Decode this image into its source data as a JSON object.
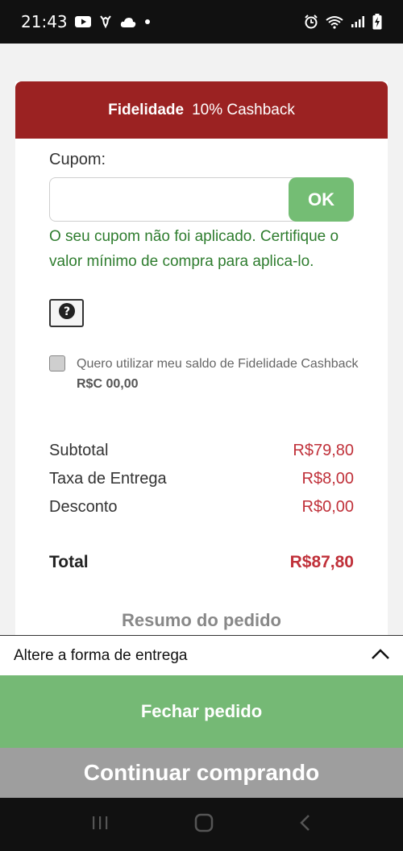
{
  "status_bar": {
    "time": "21:43",
    "icons_left": [
      "youtube-icon",
      "deer-app-icon",
      "cloud-icon",
      "dot-icon"
    ],
    "icons_right": [
      "alarm-icon",
      "wifi-icon",
      "signal-icon",
      "battery-charging-icon"
    ]
  },
  "card": {
    "header_bold": "Fidelidade",
    "header_text": "10% Cashback",
    "coupon_label": "Cupom:",
    "coupon_value": "",
    "ok_label": "OK",
    "coupon_message": "O seu cupom não foi aplicado. Certifique o valor mínimo de compra para aplica-lo.",
    "help_icon": "question-circle-icon",
    "cashback_text": "Quero utilizar meu saldo de Fidelidade Cashback",
    "cashback_value": "R$C 00,00",
    "cashback_checked": false
  },
  "summary": {
    "subtotal_label": "Subtotal",
    "subtotal_value": "R$79,80",
    "delivery_label": "Taxa de Entrega",
    "delivery_value": "R$8,00",
    "discount_label": "Desconto",
    "discount_value": "R$0,00",
    "total_label": "Total",
    "total_value": "R$87,80",
    "resumo_label": "Resumo do pedido"
  },
  "footer": {
    "delivery_text": "Altere a forma de entrega",
    "fechar_label": "Fechar pedido",
    "continuar_label": "Continuar comprando"
  },
  "colors": {
    "brand": "#9b2222",
    "success": "#74bd74",
    "price": "#c0313a",
    "secondary_button": "#9e9e9e"
  }
}
